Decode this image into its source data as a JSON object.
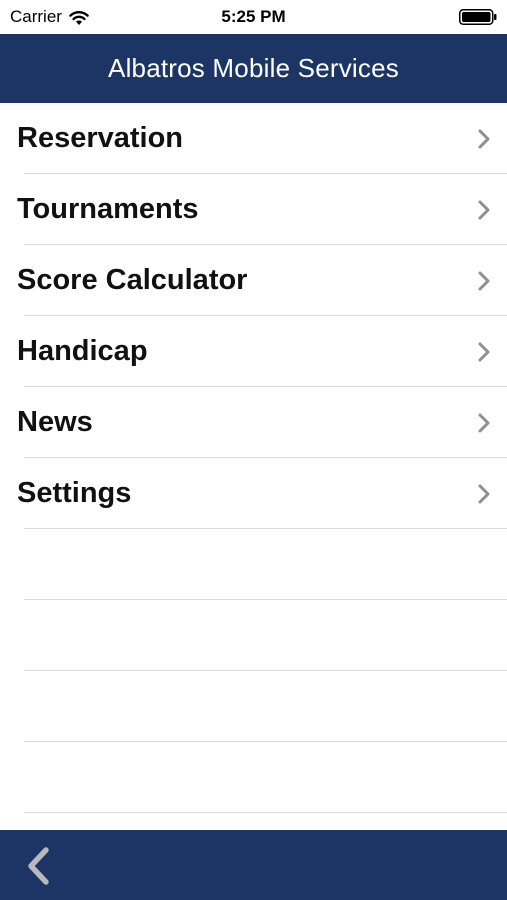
{
  "status_bar": {
    "carrier": "Carrier",
    "time": "5:25 PM",
    "wifi_icon": "wifi-icon",
    "battery_icon": "battery-icon"
  },
  "nav": {
    "title": "Albatros Mobile Services"
  },
  "menu": {
    "items": [
      {
        "label": "Reservation"
      },
      {
        "label": "Tournaments"
      },
      {
        "label": "Score Calculator"
      },
      {
        "label": "Handicap"
      },
      {
        "label": "News"
      },
      {
        "label": "Settings"
      }
    ],
    "row_icon": "chevron-right-icon"
  },
  "toolbar": {
    "back_icon": "back-chevron-icon"
  },
  "colors": {
    "bar_background": "#1c3565",
    "chevron": "#8e8e93",
    "separator": "#dcdcdc"
  }
}
